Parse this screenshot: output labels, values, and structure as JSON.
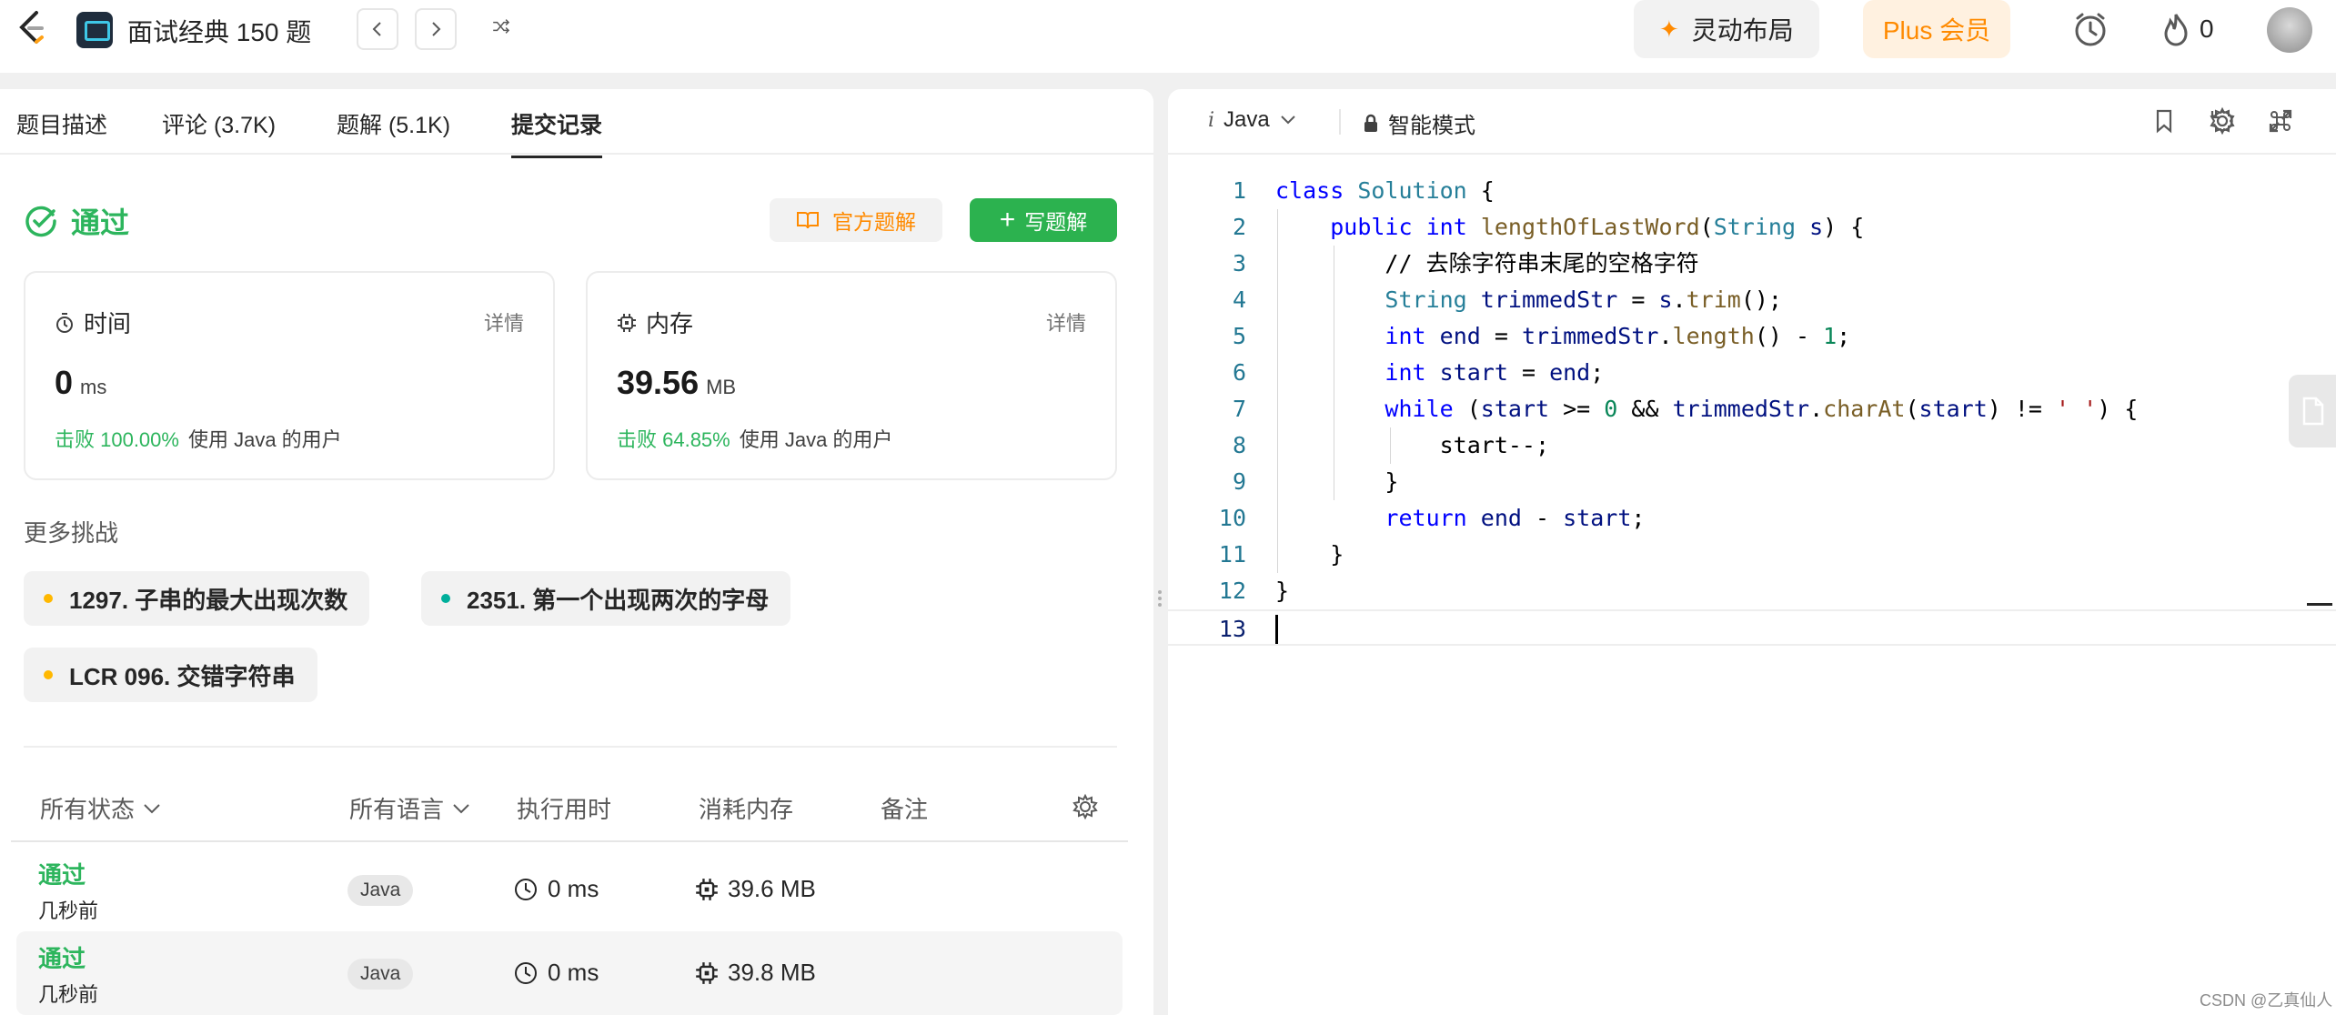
{
  "topbar": {
    "problem_list": "面试经典 150 题",
    "dynamic_layout": "灵动布局",
    "plus_label": "Plus 会员",
    "fire_count": "0"
  },
  "tabs": [
    "题目描述",
    "评论 (3.7K)",
    "题解 (5.1K)",
    "提交记录"
  ],
  "result": {
    "status": "通过",
    "official_btn": "官方题解",
    "write_btn": "写题解",
    "time": {
      "label": "时间",
      "detail": "详情",
      "value": "0",
      "unit": "ms",
      "beat_pct": "击败 100.00%",
      "beat_text": "使用 Java 的用户"
    },
    "memory": {
      "label": "内存",
      "detail": "详情",
      "value": "39.56",
      "unit": "MB",
      "beat_pct": "击败 64.85%",
      "beat_text": "使用 Java 的用户"
    }
  },
  "more": {
    "title": "更多挑战",
    "chips": [
      {
        "label": "1297. 子串的最大出现次数",
        "color": "#ffb800"
      },
      {
        "label": "2351. 第一个出现两次的字母",
        "color": "#00af9b"
      },
      {
        "label": "LCR 096. 交错字符串",
        "color": "#ffb800"
      }
    ]
  },
  "table": {
    "headers": [
      "所有状态",
      "所有语言",
      "执行用时",
      "消耗内存",
      "备注"
    ],
    "rows": [
      {
        "status": "通过",
        "when": "几秒前",
        "lang": "Java",
        "runtime": "0 ms",
        "memory": "39.6 MB"
      },
      {
        "status": "通过",
        "when": "几秒前",
        "lang": "Java",
        "runtime": "0 ms",
        "memory": "39.8 MB"
      }
    ]
  },
  "editor": {
    "language": "Java",
    "lang_icon": "i",
    "mode": "智能模式",
    "line_numbers": [
      "1",
      "2",
      "3",
      "4",
      "5",
      "6",
      "7",
      "8",
      "9",
      "10",
      "11",
      "12",
      "13"
    ],
    "code": [
      "class Solution {",
      "    public int lengthOfLastWord(String s) {",
      "        // 去除字符串末尾的空格字符",
      "        String trimmedStr = s.trim();",
      "        int end = trimmedStr.length() - 1;",
      "        int start = end;",
      "        while (start >= 0 && trimmedStr.charAt(start) != ' ') {",
      "            start--;",
      "        }",
      "        return end - start;",
      "    }",
      "}",
      ""
    ]
  },
  "watermark": "CSDN @乙真仙人",
  "colors": {
    "accepted": "#2db55d",
    "brand_orange": "#ff8a00",
    "write_green": "#2cb24f"
  }
}
